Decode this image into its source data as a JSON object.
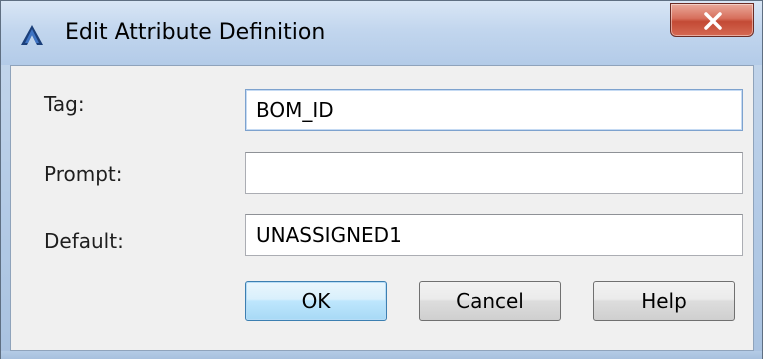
{
  "window": {
    "title": "Edit Attribute Definition",
    "app_icon": "autocad-logo-icon",
    "close_icon": "close-icon",
    "close_label": "X"
  },
  "form": {
    "tag": {
      "label": "Tag:",
      "value": "BOM_ID",
      "placeholder": ""
    },
    "prompt": {
      "label": "Prompt:",
      "value": "",
      "placeholder": ""
    },
    "default": {
      "label": "Default:",
      "value": "UNASSIGNED1",
      "placeholder": ""
    }
  },
  "buttons": {
    "ok": "OK",
    "cancel": "Cancel",
    "help": "Help"
  },
  "colors": {
    "titlebar": "#c2d6ee",
    "close_button": "#c34a35",
    "client_background": "#f0f0f0",
    "default_button_border": "#3c7fb1"
  }
}
